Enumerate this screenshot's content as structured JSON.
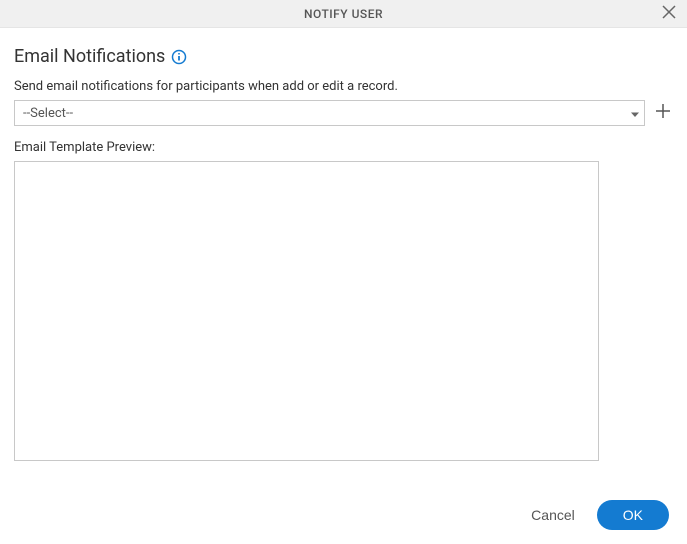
{
  "header": {
    "title": "NOTIFY USER"
  },
  "section": {
    "title": "Email Notifications",
    "description": "Send email notifications for participants when add or edit a record."
  },
  "select": {
    "value": "--Select--"
  },
  "preview": {
    "label": "Email Template Preview:"
  },
  "footer": {
    "cancel": "Cancel",
    "ok": "OK"
  }
}
